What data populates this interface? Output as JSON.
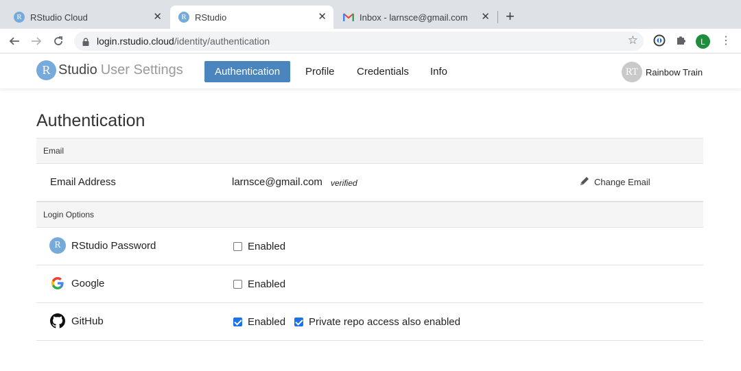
{
  "browser": {
    "tabs": [
      {
        "label": "RStudio Cloud",
        "favicon": "rstudio-icon",
        "active": false
      },
      {
        "label": "RStudio",
        "favicon": "rstudio-icon",
        "active": true
      },
      {
        "label": "Inbox - larnsce@gmail.com - G",
        "favicon": "gmail-icon",
        "active": false
      }
    ],
    "close_glyph": "✕",
    "new_tab_glyph": "+",
    "url_host": "login.rstudio.cloud",
    "url_path": "/identity/authentication",
    "profile_initial": "L"
  },
  "app": {
    "logo_letter": "R",
    "brand_studio": "Studio",
    "brand_suffix": "User Settings",
    "nav": [
      {
        "label": "Authentication",
        "active": true
      },
      {
        "label": "Profile",
        "active": false
      },
      {
        "label": "Credentials",
        "active": false
      },
      {
        "label": "Info",
        "active": false
      }
    ],
    "user": {
      "initials": "RT",
      "name": "Rainbow Train"
    }
  },
  "main": {
    "title": "Authentication",
    "email_section": {
      "heading": "Email",
      "label": "Email Address",
      "value": "larnsce@gmail.com",
      "status": "verified",
      "action": "Change Email"
    },
    "login_section": {
      "heading": "Login Options",
      "options": [
        {
          "name": "RStudio Password",
          "icon": "rstudio-icon",
          "enabled_label": "Enabled",
          "enabled": false
        },
        {
          "name": "Google",
          "icon": "google-icon",
          "enabled_label": "Enabled",
          "enabled": false
        },
        {
          "name": "GitHub",
          "icon": "github-icon",
          "enabled_label": "Enabled",
          "enabled": true,
          "extra_label": "Private repo access also enabled",
          "extra_enabled": true
        }
      ]
    }
  },
  "colors": {
    "accent": "#4a86bd",
    "rstudio_blue": "#75aadb",
    "checkbox_blue": "#1a73e8"
  }
}
